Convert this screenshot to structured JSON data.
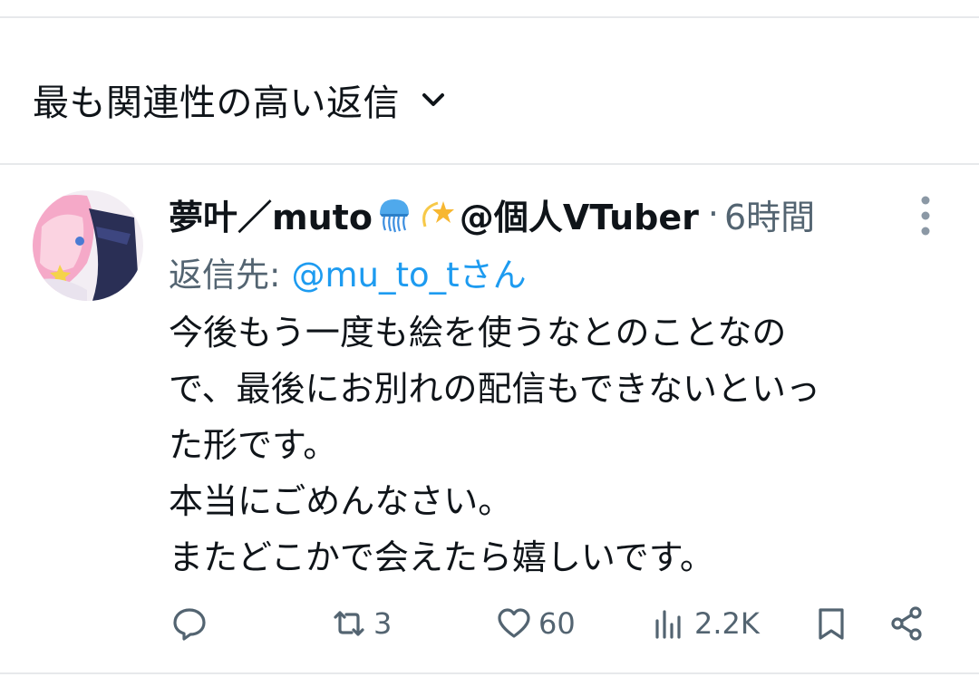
{
  "sort": {
    "label": "最も関連性の高い返信",
    "icon": "chevron-down-icon"
  },
  "tweet": {
    "author": {
      "name_prefix": "夢叶／muto",
      "name_suffix": "@個人VTuber",
      "emojis": [
        "jellyfish",
        "dizzy-star"
      ]
    },
    "time_sep": "·",
    "time": "6時間",
    "reply_prefix": "返信先:",
    "reply_handle": "@mu_to_tさん",
    "body_lines": [
      "今後もう一度も絵を使うなとのことなの",
      "で、最後にお別れの配信もできないといっ",
      "た形です。",
      "本当にごめんなさい。",
      "またどこかで会えたら嬉しいです。"
    ],
    "actions": {
      "reply": {
        "icon": "reply-icon",
        "count": ""
      },
      "retweet": {
        "icon": "retweet-icon",
        "count": "3"
      },
      "like": {
        "icon": "heart-icon",
        "count": "60"
      },
      "views": {
        "icon": "views-icon",
        "count": "2.2K"
      },
      "bookmark": {
        "icon": "bookmark-icon"
      },
      "share": {
        "icon": "share-icon"
      }
    }
  },
  "colors": {
    "text": "#0f1419",
    "secondary": "#536471",
    "link": "#1d9bf0",
    "divider": "#e7e9eb"
  }
}
